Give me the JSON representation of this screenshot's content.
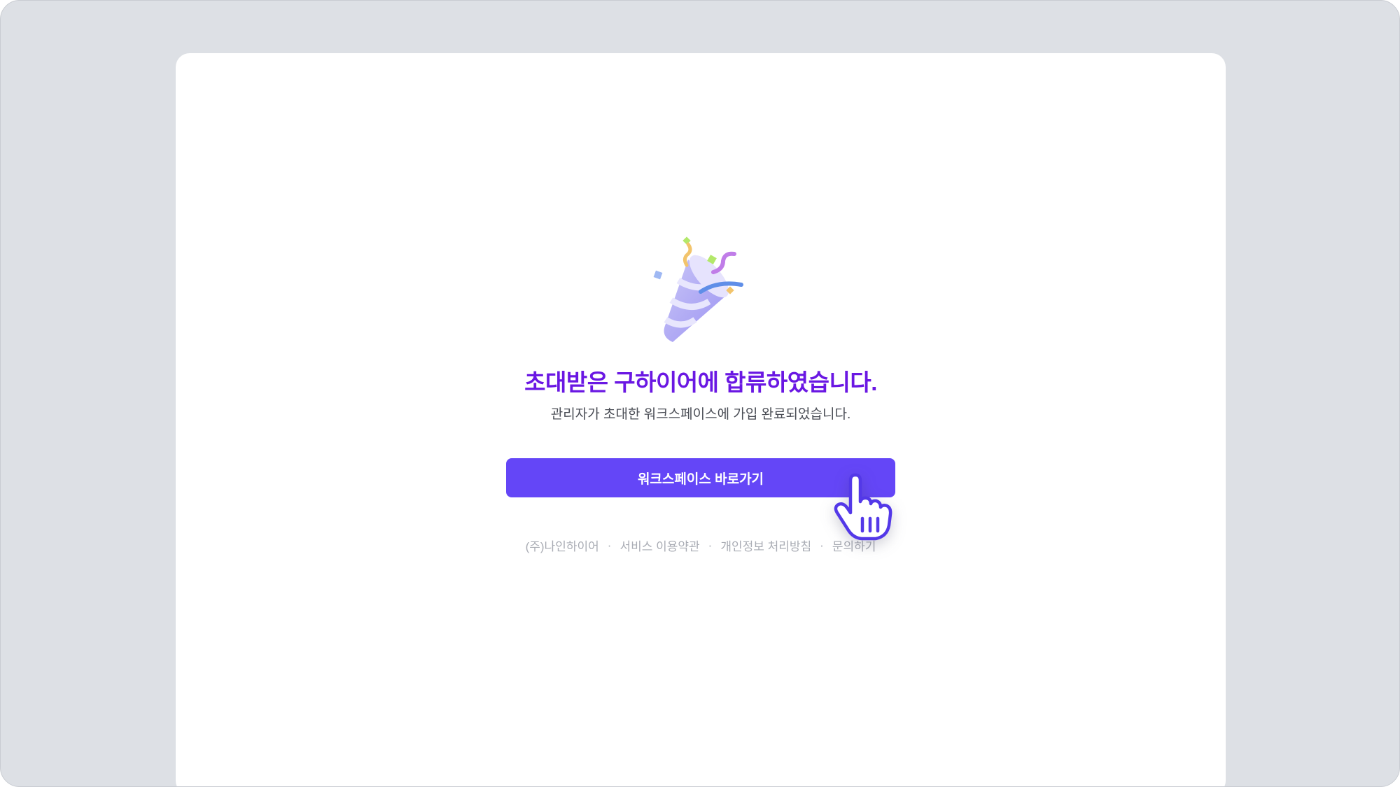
{
  "main": {
    "headline": "초대받은 구하이어에 합류하였습니다.",
    "subline": "관리자가 초대한 워크스페이스에 가입 완료되었습니다.",
    "cta_label": "워크스페이스 바로가기"
  },
  "footer": {
    "company": "(주)나인하이어",
    "separator": "·",
    "links": [
      {
        "label": "서비스 이용약관"
      },
      {
        "label": "개인정보 처리방침"
      },
      {
        "label": "문의하기"
      }
    ]
  },
  "icons": {
    "illustration": "party-popper-icon",
    "cursor": "hand-pointer-icon"
  },
  "colors": {
    "background": "#dde0e5",
    "panel": "#ffffff",
    "headline": "#6a17e3",
    "cta": "#6446f7",
    "footer_text": "#a9acb4"
  }
}
